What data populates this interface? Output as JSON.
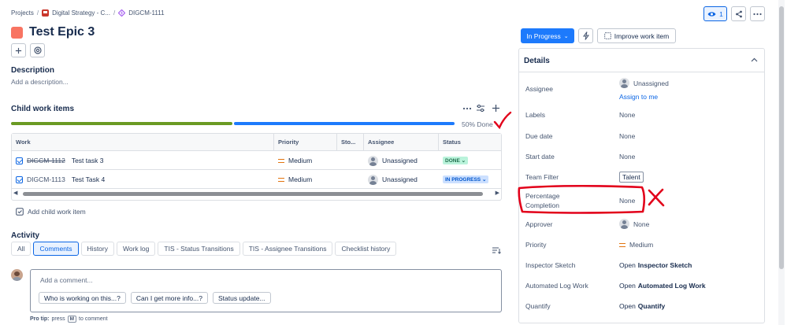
{
  "breadcrumb": {
    "projects": "Projects",
    "project": "Digital Strategy - C...",
    "issue_key": "DIGCM-1111"
  },
  "header": {
    "title": "Test Epic 3",
    "watch_count": "1",
    "status": "In Progress",
    "improve_label": "Improve work item"
  },
  "description": {
    "heading": "Description",
    "placeholder": "Add a description..."
  },
  "child_items": {
    "heading": "Child work items",
    "progress_text": "50% Done",
    "progress": 0.5,
    "columns": [
      "Work",
      "Priority",
      "Sto...",
      "Assignee",
      "Status"
    ],
    "rows": [
      {
        "key": "DIGCM-1112",
        "summary": "Test task 3",
        "priority": "Medium",
        "assignee": "Unassigned",
        "status": "DONE",
        "done": true
      },
      {
        "key": "DIGCM-1113",
        "summary": "Test Task 4",
        "priority": "Medium",
        "assignee": "Unassigned",
        "status": "IN PROGRESS",
        "done": false
      }
    ],
    "add_label": "Add child work item"
  },
  "activity": {
    "heading": "Activity",
    "tabs": [
      "All",
      "Comments",
      "History",
      "Work log",
      "TIS - Status Transitions",
      "TIS - Assignee Transitions",
      "Checklist history"
    ],
    "active_tab": "Comments",
    "comment_placeholder": "Add a comment...",
    "suggestions": [
      "Who is working on this...?",
      "Can I get more info...?",
      "Status update..."
    ],
    "tip_prefix": "Pro tip:",
    "tip_text": "press",
    "tip_key": "M",
    "tip_suffix": "to comment"
  },
  "details": {
    "heading": "Details",
    "assignee_label": "Assignee",
    "assignee_value": "Unassigned",
    "assign_to_me": "Assign to me",
    "labels_label": "Labels",
    "labels_value": "None",
    "due_label": "Due date",
    "due_value": "None",
    "start_label": "Start date",
    "start_value": "None",
    "team_label": "Team Filter",
    "team_value": "Talent",
    "pct_label_1": "Percentage",
    "pct_label_2": "Completion",
    "pct_value": "None",
    "approver_label": "Approver",
    "approver_value": "None",
    "priority_label": "Priority",
    "priority_value": "Medium",
    "inspector_label": "Inspector Sketch",
    "inspector_open": "Open",
    "inspector_value": "Inspector Sketch",
    "autolog_label": "Automated Log Work",
    "autolog_open": "Open",
    "autolog_value": "Automated Log Work",
    "quantify_label": "Quantify",
    "quantify_open": "Open",
    "quantify_value": "Quantify"
  },
  "colors": {
    "done_bar": "#6a9a23",
    "progress_bar": "#1d7afc",
    "annotation_red": "#e2001a",
    "status_button": "#1d7afc"
  }
}
